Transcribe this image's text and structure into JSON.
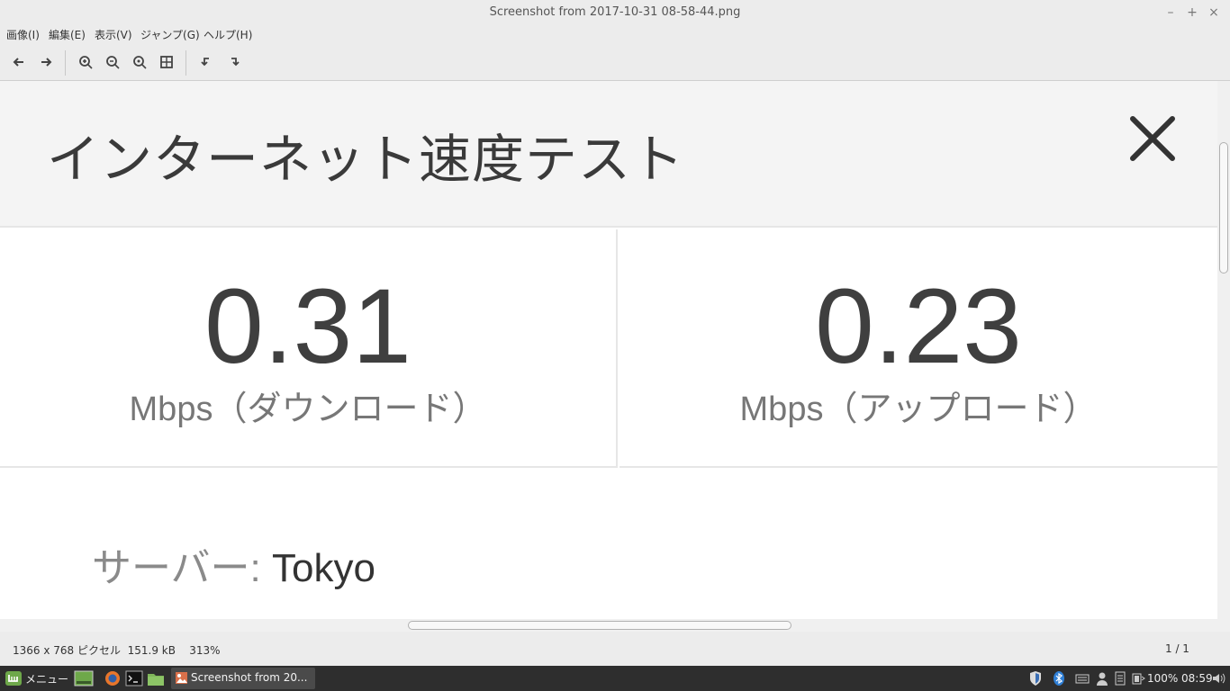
{
  "window": {
    "title": "Screenshot from 2017-10-31 08-58-44.png",
    "minimize": "–",
    "maximize": "+",
    "close": "×"
  },
  "menu": [
    "画像(I)",
    "編集(E)",
    "表示(V)",
    "ジャンプ(G)",
    "ヘルプ(H)"
  ],
  "toolbar": {
    "icons": [
      "arrow-left-icon",
      "arrow-right-icon",
      "zoom-in-icon",
      "zoom-out-icon",
      "zoom-normal-icon",
      "zoom-fit-icon",
      "rotate-left-icon",
      "rotate-right-icon"
    ]
  },
  "content": {
    "title": "インターネット速度テスト",
    "download": {
      "value": "0.31",
      "unit": "Mbps（ダウンロード）"
    },
    "upload": {
      "value": "0.23",
      "unit": "Mbps（アップロード）"
    },
    "server_label": "サーバー: ",
    "server_value": "Tokyo"
  },
  "status": {
    "info": "1366 x 768 ピクセル  151.9 kB    313%",
    "page": "1 / 1"
  },
  "taskbar": {
    "menu_label": "メニュー",
    "window_label": "Screenshot from 20...",
    "battery": "100%",
    "clock": "08:59"
  },
  "colors": {
    "accent_green": "#6ea84a",
    "taskbar_bg": "#2e2e2e"
  }
}
